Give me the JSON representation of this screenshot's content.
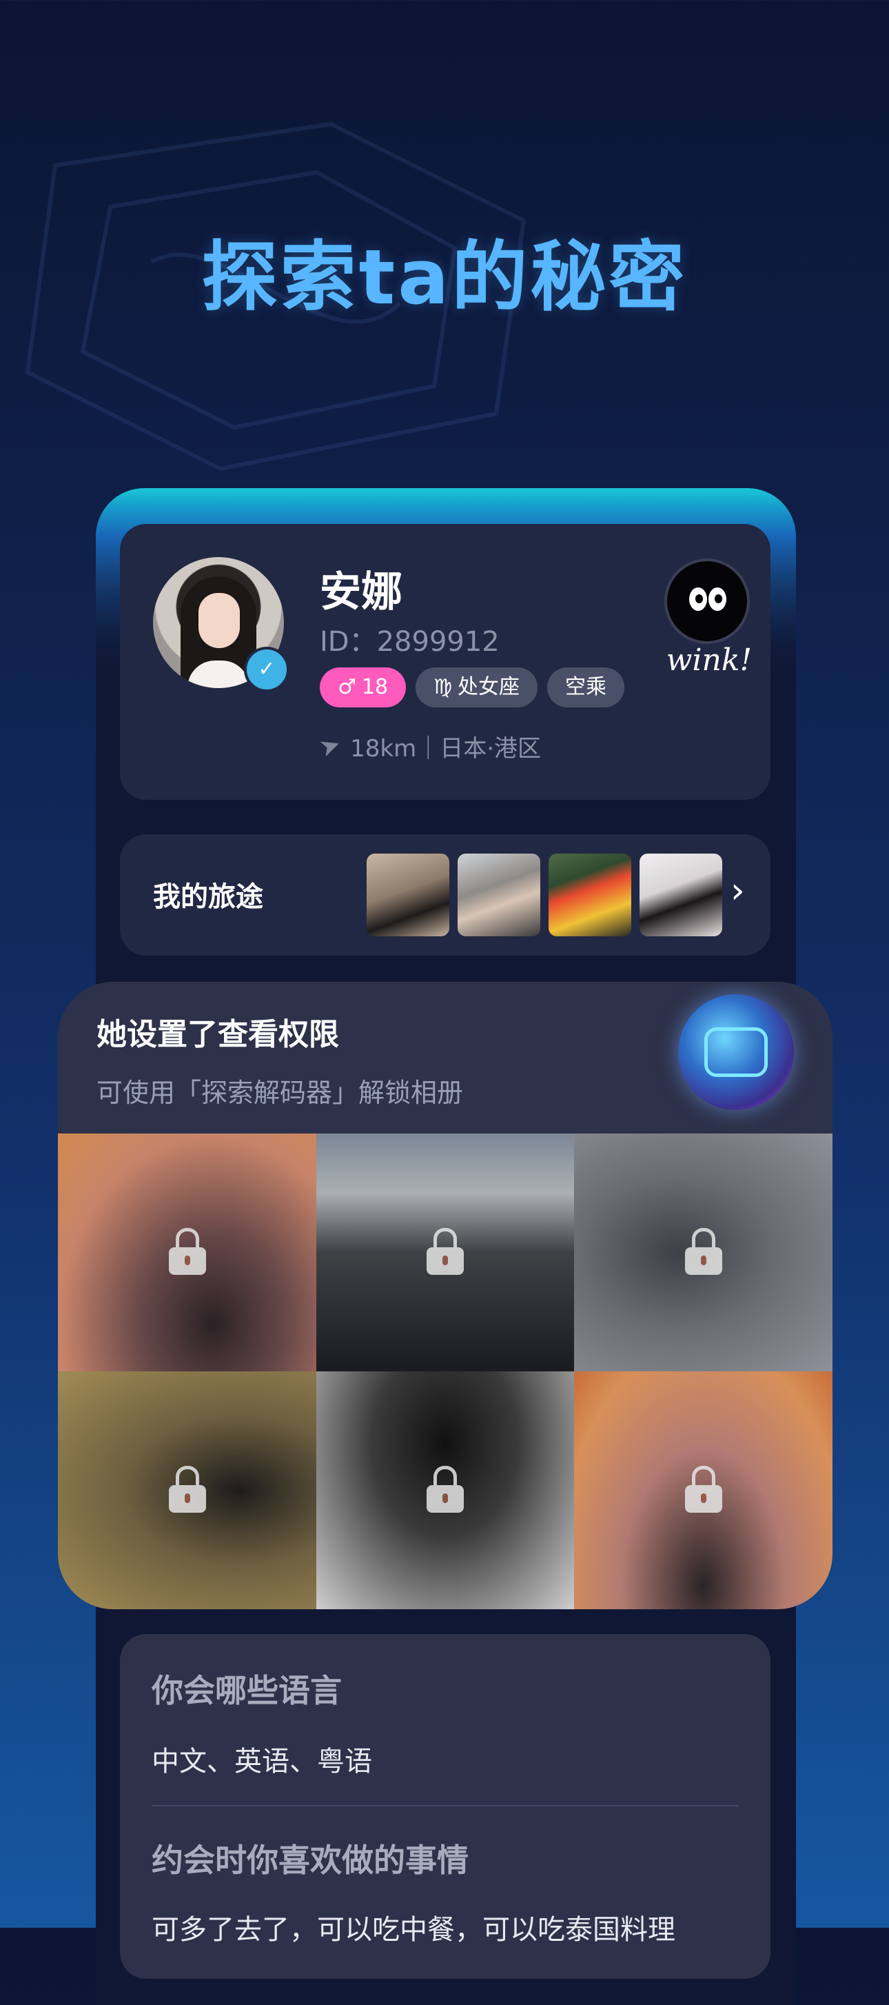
{
  "headline": "探索ta的秘密",
  "profile": {
    "name": "安娜",
    "id_text": "ID：2899912",
    "tags": [
      {
        "icon": "♂",
        "label": "18",
        "color": "#ff5bbd"
      },
      {
        "icon": "♍",
        "label": "处女座",
        "color": "#4a5068"
      },
      {
        "icon": "",
        "label": "空乘",
        "color": "#4a5068"
      }
    ],
    "location": "18km｜日本·港区",
    "wink_label": "wink!"
  },
  "trip": {
    "label": "我的旅途"
  },
  "album": {
    "title": "她设置了查看权限",
    "subtitle": "可使用「探索解码器」解锁相册",
    "locked_count": 6
  },
  "qa": [
    {
      "question": "你会哪些语言",
      "answer": "中文、英语、粤语"
    },
    {
      "question": "约会时你喜欢做的事情",
      "answer": "可多了去了，可以吃中餐，可以吃泰国料理"
    }
  ],
  "colors": {
    "accent": "#57b6ff",
    "pink": "#ff5bbd",
    "card": "#212843"
  }
}
